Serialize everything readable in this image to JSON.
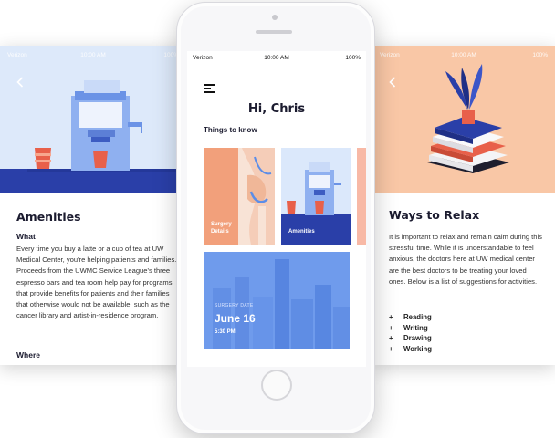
{
  "left_card": {
    "status": {
      "carrier": "Verizon",
      "time": "10:00 AM",
      "battery": "100%"
    },
    "title": "Amenities",
    "section1": "What",
    "body": "Every time you buy a latte or a cup of tea at UW Medical Center, you're helping patients and families. Proceeds from the UWMC Service League's three espresso bars and tea room help pay for programs that provide benefits for patients and their families that otherwise would not be available, such as the cancer library and artist-in-residence program.",
    "section2": "Where"
  },
  "phone": {
    "status": {
      "carrier": "Verizon",
      "time": "10:00 AM",
      "battery": "100%"
    },
    "greeting": "Hi, Chris",
    "section_title": "Things to know",
    "tiles": [
      {
        "label_line1": "Surgery",
        "label_line2": "Details"
      },
      {
        "label_line1": "Amenities"
      }
    ],
    "surgery": {
      "caption": "SURGERY DATE",
      "date": "June 16",
      "time": "5:30 PM"
    }
  },
  "right_card": {
    "status": {
      "carrier": "Verizon",
      "time": "10:00 AM",
      "battery": "100%"
    },
    "title": "Ways to Relax",
    "body": "It is important to relax and remain calm during this stressful time.  While it is understandable to feel anxious, the doctors here at UW medical center are the best doctors to be treating your loved ones. Below is a list of suggestions for activities.",
    "bullet_marker": "+",
    "activities": [
      "Reading",
      "Writing",
      "Drawing",
      "Working"
    ]
  },
  "icons": {
    "back": "chevron-left-icon",
    "menu": "hamburger-menu-icon",
    "signal": "signal-bars-icon",
    "wifi": "wifi-icon",
    "bluetooth": "bluetooth-icon",
    "battery": "battery-icon"
  },
  "colors": {
    "navy": "#2a3fa8",
    "blue": "#5b8de8",
    "peach": "#f9c7a6",
    "coral": "#f2a07b",
    "light_blue": "#dde9fa"
  }
}
